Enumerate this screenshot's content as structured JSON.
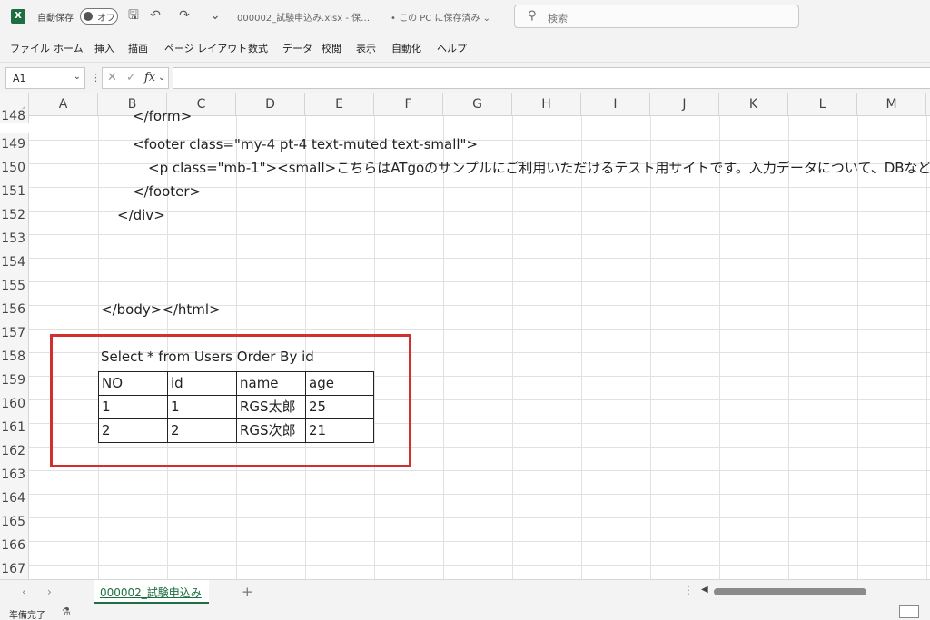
{
  "titlebar": {
    "logo": "X",
    "autosave_label": "自動保存",
    "autosave_state": "オフ",
    "filename": "000002_試験申込み.xlsx  -  保…",
    "save_state": "• この PC に保存済み ⌄",
    "search_placeholder": "検索"
  },
  "menu": [
    "ファイル",
    "ホーム",
    "挿入",
    "描画",
    "ページ レイアウト",
    "数式",
    "データ",
    "校閲",
    "表示",
    "自動化",
    "ヘルプ"
  ],
  "formula_bar": {
    "name_box": "A1",
    "fx_label": "fx"
  },
  "columns": [
    "A",
    "B",
    "C",
    "D",
    "E",
    "F",
    "G",
    "H",
    "I",
    "J",
    "K",
    "L",
    "M"
  ],
  "rows": [
    "148",
    "149",
    "150",
    "151",
    "152",
    "153",
    "154",
    "155",
    "156",
    "157",
    "158",
    "159",
    "160",
    "161",
    "162",
    "163",
    "164",
    "165",
    "166",
    "167"
  ],
  "code_lines": {
    "r148": "</form>",
    "r149": "<footer class=\"my-4 pt-4 text-muted text-small\">",
    "r150": "<p class=\"mb-1\"><small>こちらはATgoのサンプルにご利用いただけるテスト用サイトです。入力データについて、DBなど",
    "r151": "</footer>",
    "r152": "</div>",
    "r156": "</body></html>"
  },
  "query": {
    "title": "Select * from Users Order By id",
    "headers": [
      "NO",
      "id",
      "name",
      "age"
    ],
    "rows": [
      [
        "1",
        "1",
        "RGS太郎",
        "25"
      ],
      [
        "2",
        "2",
        "RGS次郎",
        "21"
      ]
    ]
  },
  "sheet_tab": "000002_試験申込み",
  "add_sheet": "+",
  "status": "準備完了"
}
